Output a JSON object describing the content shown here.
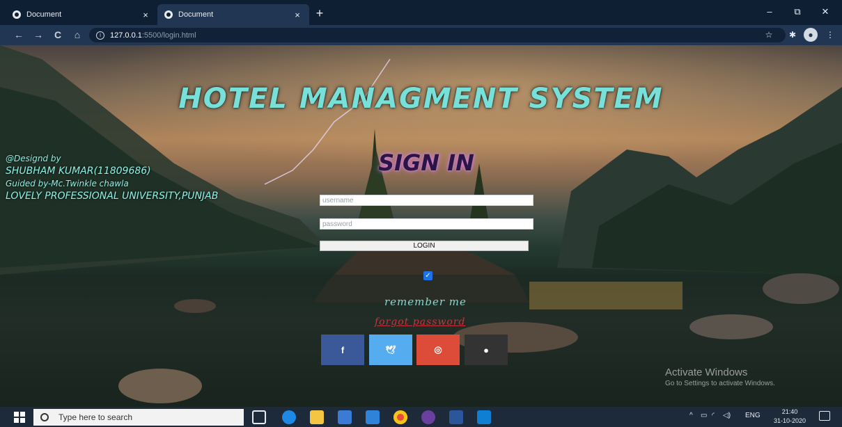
{
  "browser": {
    "tabs": [
      {
        "title": "Document",
        "close": "×"
      },
      {
        "title": "Document",
        "close": "×"
      }
    ],
    "new_tab": "+",
    "window_controls": {
      "minimize": "–",
      "restore": "⧉",
      "close": "✕"
    },
    "nav": {
      "back": "←",
      "forward": "→",
      "reload": "C",
      "home": "⌂"
    },
    "address": {
      "host": "127.0.0.1",
      "path": ":5500/login.html"
    }
  },
  "page": {
    "title": "HOTEL MANAGMENT SYSTEM",
    "sign_in": "SIGN IN",
    "credits": [
      "@Designd by",
      "SHUBHAM KUMAR(11809686)",
      "Guided by-Mc.Twinkle chawla",
      "LOVELY PROFESSIONAL UNIVERSITY,PUNJAB"
    ],
    "username_placeholder": "username",
    "password_placeholder": "password",
    "login_label": "LOGIN",
    "remember_checked": true,
    "remember_label": "remember me",
    "forgot_label": "forgot password",
    "social": [
      {
        "glyph": "f",
        "color": "#3b5998"
      },
      {
        "glyph": "🐦",
        "color": "#55acee"
      },
      {
        "glyph": "◎",
        "color": "#dd4b39"
      },
      {
        "glyph": "●",
        "color": "#333333"
      }
    ],
    "activate_title": "Activate Windows",
    "activate_sub": "Go to Settings to activate Windows."
  },
  "taskbar": {
    "search_placeholder": "Type here to search",
    "language": "ENG",
    "time": "21:40",
    "date": "31-10-2020"
  }
}
